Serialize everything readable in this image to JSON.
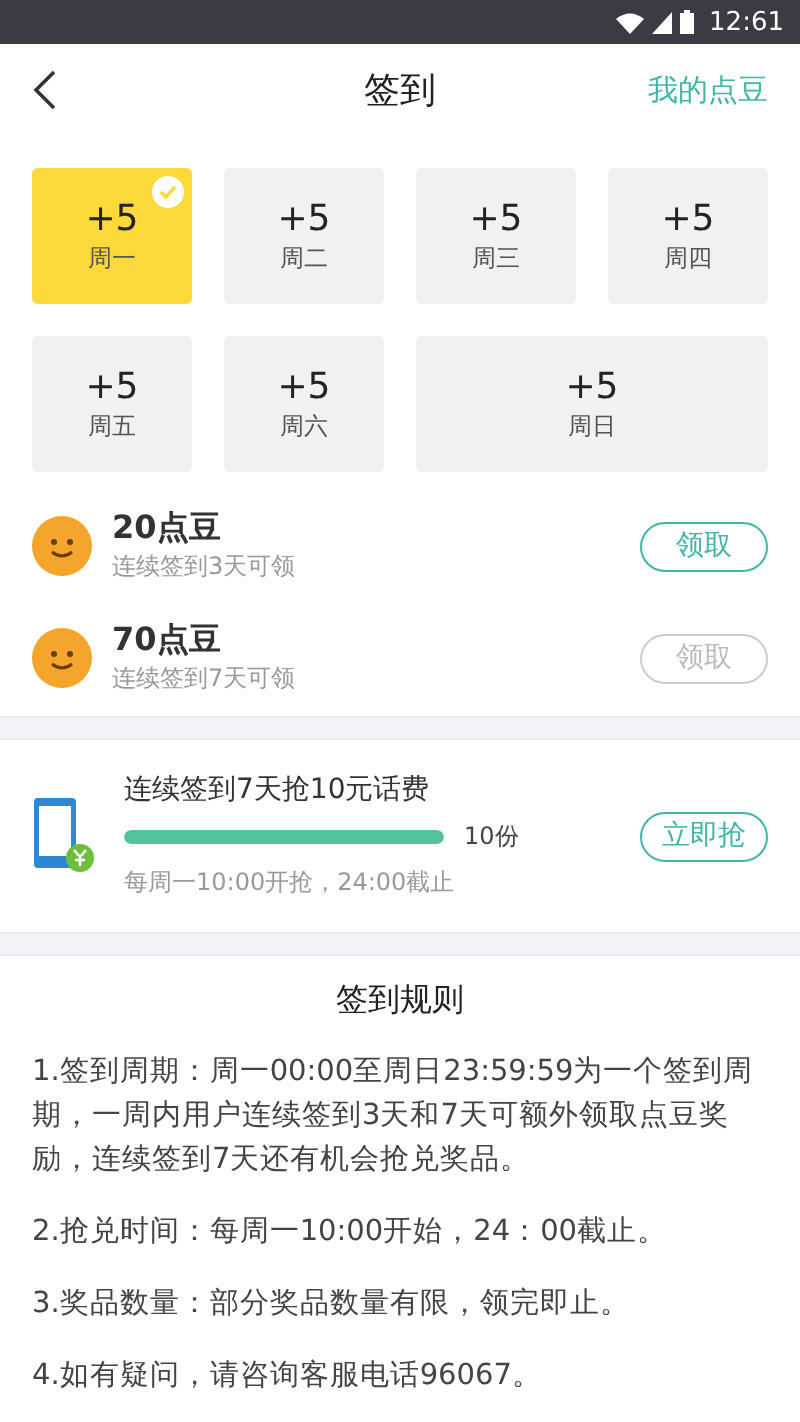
{
  "status_bar": {
    "time": "12:61"
  },
  "header": {
    "title": "签到",
    "action": "我的点豆"
  },
  "days": [
    {
      "points": "+5",
      "label": "周一",
      "checked": true
    },
    {
      "points": "+5",
      "label": "周二",
      "checked": false
    },
    {
      "points": "+5",
      "label": "周三",
      "checked": false
    },
    {
      "points": "+5",
      "label": "周四",
      "checked": false
    },
    {
      "points": "+5",
      "label": "周五",
      "checked": false
    },
    {
      "points": "+5",
      "label": "周六",
      "checked": false
    },
    {
      "points": "+5",
      "label": "周日",
      "checked": false,
      "wide": true
    }
  ],
  "rewards": [
    {
      "title": "20点豆",
      "subtitle": "连续签到3天可领",
      "button": "领取",
      "disabled": false
    },
    {
      "title": "70点豆",
      "subtitle": "连续签到7天可领",
      "button": "领取",
      "disabled": true
    }
  ],
  "promo": {
    "title": "连续签到7天抢10元话费",
    "count": "10份",
    "note": "每周一10:00开抢，24:00截止",
    "button": "立即抢"
  },
  "rules": {
    "title": "签到规则",
    "items": [
      "1.签到周期：周一00:00至周日23:59:59为一个签到周期，一周内用户连续签到3天和7天可额外领取点豆奖励，连续签到7天还有机会抢兑奖品。",
      "2.抢兑时间：每周一10:00开始，24：00截止。",
      "3.奖品数量：部分奖品数量有限，领完即止。",
      "4.如有疑问，请咨询客服电话96067。"
    ]
  }
}
